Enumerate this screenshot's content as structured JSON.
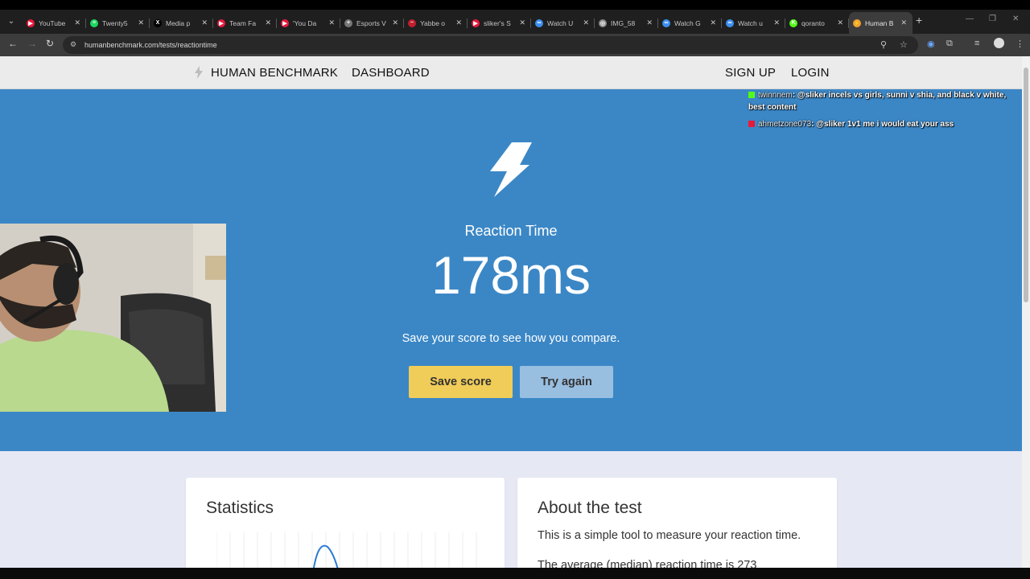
{
  "browser": {
    "tabs": [
      {
        "title": "YouTube",
        "favicon_color": "#e8193c",
        "favicon_glyph": "▶",
        "active": false
      },
      {
        "title": "Twenty5",
        "favicon_color": "#1ed760",
        "favicon_glyph": "≡",
        "active": false
      },
      {
        "title": "Media p",
        "favicon_color": "#000000",
        "favicon_glyph": "X",
        "active": false
      },
      {
        "title": "Team Fa",
        "favicon_color": "#e8193c",
        "favicon_glyph": "▶",
        "active": false
      },
      {
        "title": "'You Da",
        "favicon_color": "#e8193c",
        "favicon_glyph": "▶",
        "active": false
      },
      {
        "title": "Esports V",
        "favicon_color": "#777777",
        "favicon_glyph": "+",
        "active": false
      },
      {
        "title": "Yabbe o",
        "favicon_color": "#c21f2f",
        "favicon_glyph": "~",
        "active": false
      },
      {
        "title": "sliker's S",
        "favicon_color": "#e8193c",
        "favicon_glyph": "▶",
        "active": false
      },
      {
        "title": "Watch U",
        "favicon_color": "#3d8ff0",
        "favicon_glyph": "∞",
        "active": false
      },
      {
        "title": "IMG_58",
        "favicon_color": "#8a8a8a",
        "favicon_glyph": "◎",
        "active": false
      },
      {
        "title": "Watch G",
        "favicon_color": "#3d8ff0",
        "favicon_glyph": "∞",
        "active": false
      },
      {
        "title": "Watch u",
        "favicon_color": "#3d8ff0",
        "favicon_glyph": "∞",
        "active": false
      },
      {
        "title": "qoranto",
        "favicon_color": "#53fc18",
        "favicon_glyph": "K",
        "active": false
      },
      {
        "title": "Human B",
        "favicon_color": "#f0a030",
        "favicon_glyph": "⚡",
        "active": true
      }
    ],
    "url": "humanbenchmark.com/tests/reactiontime"
  },
  "site_nav": {
    "brand": "HUMAN BENCHMARK",
    "dashboard": "DASHBOARD",
    "signup": "SIGN UP",
    "login": "LOGIN"
  },
  "hero": {
    "title": "Reaction Time",
    "result": "178ms",
    "subtitle": "Save your score to see how you compare.",
    "save_label": "Save score",
    "try_label": "Try again",
    "bg_color": "#3b87c6"
  },
  "chat": [
    {
      "user": "twinnnem",
      "message": ": @sliker incels vs girls, sunni v shia, and black v white, best content",
      "badge_color": "#53fc18"
    },
    {
      "user": "ahmetzone073",
      "message": ": @sliker 1v1 me i would eat your ass",
      "badge_color": "#e8193c"
    }
  ],
  "stats": {
    "title": "Statistics"
  },
  "about": {
    "title": "About the test",
    "p1": "This is a simple tool to measure your reaction time.",
    "p2": "The average (median) reaction time is 273"
  }
}
